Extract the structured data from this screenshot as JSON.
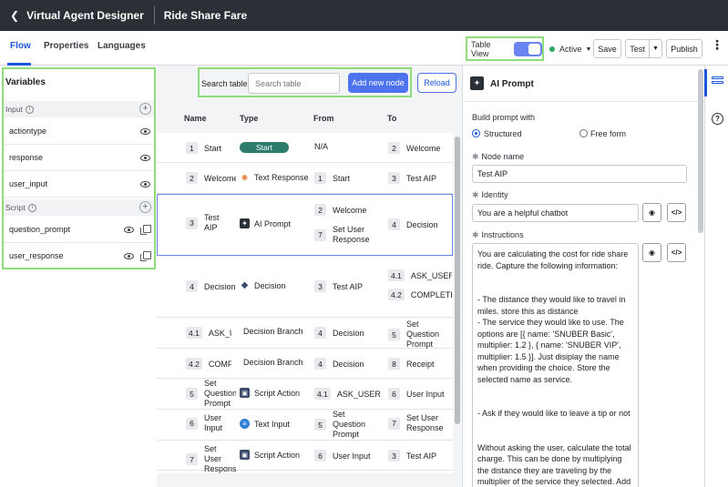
{
  "topbar": {
    "back_label": "Virtual Agent Designer",
    "title": "Ride Share Fare"
  },
  "tabs": [
    {
      "label": "Flow"
    },
    {
      "label": "Properties"
    },
    {
      "label": "Languages"
    }
  ],
  "toolbar": {
    "table_view_label": "Table View",
    "table_view_on": true,
    "status_label": "Active",
    "save_label": "Save",
    "test_label": "Test",
    "publish_label": "Publish"
  },
  "variables": {
    "title": "Variables",
    "input_label": "Input",
    "input_items": [
      {
        "name": "actiontype"
      },
      {
        "name": "response"
      },
      {
        "name": "user_input"
      }
    ],
    "script_label": "Script",
    "script_items": [
      {
        "name": "question_prompt"
      },
      {
        "name": "user_response"
      }
    ]
  },
  "search": {
    "label": "Search table",
    "placeholder": "Search table",
    "add_label": "Add new node",
    "reload_label": "Reload"
  },
  "table": {
    "headers": {
      "name": "Name",
      "type": "Type",
      "from": "From",
      "to": "To"
    },
    "rows": [
      {
        "num": "1",
        "name": "Start",
        "type": "Start",
        "from": [
          {
            "num": "",
            "label": "N/A"
          }
        ],
        "to": [
          {
            "num": "2",
            "label": "Welcome"
          }
        ]
      },
      {
        "num": "2",
        "name": "Welcome",
        "type": "Text Response",
        "from": [
          {
            "num": "1",
            "label": "Start"
          }
        ],
        "to": [
          {
            "num": "3",
            "label": "Test AIP"
          }
        ]
      },
      {
        "num": "3",
        "name": "Test AIP",
        "type": "AI Prompt",
        "from": [
          {
            "num": "2",
            "label": "Welcome"
          },
          {
            "num": "7",
            "label": "Set User Response"
          }
        ],
        "to": [
          {
            "num": "4",
            "label": "Decision"
          }
        ]
      },
      {
        "num": "4",
        "name": "Decision",
        "type": "Decision",
        "from": [
          {
            "num": "3",
            "label": "Test AIP"
          }
        ],
        "to": [
          {
            "num": "4.1",
            "label": "ASK_USER"
          },
          {
            "num": "4.2",
            "label": "COMPLETE"
          }
        ]
      },
      {
        "num": "4.1",
        "name": "ASK_USER",
        "type": "Decision Branch",
        "from": [
          {
            "num": "4",
            "label": "Decision"
          }
        ],
        "to": [
          {
            "num": "5",
            "label": "Set Question Prompt"
          }
        ]
      },
      {
        "num": "4.2",
        "name": "COMPLETE",
        "type": "Decision Branch",
        "from": [
          {
            "num": "4",
            "label": "Decision"
          }
        ],
        "to": [
          {
            "num": "8",
            "label": "Receipt"
          }
        ]
      },
      {
        "num": "5",
        "name": "Set Question Prompt",
        "type": "Script Action",
        "from": [
          {
            "num": "4.1",
            "label": "ASK_USER"
          }
        ],
        "to": [
          {
            "num": "6",
            "label": "User Input"
          }
        ]
      },
      {
        "num": "6",
        "name": "User Input",
        "type": "Text Input",
        "from": [
          {
            "num": "5",
            "label": "Set Question Prompt"
          }
        ],
        "to": [
          {
            "num": "7",
            "label": "Set User Response"
          }
        ]
      },
      {
        "num": "7",
        "name": "Set User Response",
        "type": "Script Action",
        "from": [
          {
            "num": "6",
            "label": "User Input"
          }
        ],
        "to": [
          {
            "num": "3",
            "label": "Test AIP"
          }
        ]
      }
    ]
  },
  "panel": {
    "title": "AI Prompt",
    "build_label": "Build prompt with",
    "option_structured": "Structured",
    "option_freeform": "Free form",
    "node_name_label": "Node name",
    "node_name_value": "Test AIP",
    "identity_label": "Identity",
    "identity_value": "You are a helpful chatbot",
    "instructions_label": "Instructions",
    "instructions_text": "You are calculating the cost for ride share ride. Capture the following information:\n\n\n- The distance they would like to travel in miles. store this as distance\n- The service they would like to use. The options are [{ name: 'SNUBER Basic', multiplier: 1.2 }, { name: 'SNUBER VIP', multiplier: 1.5 }]. Just disiplay the name when providing the choice. Store the selected name as service.\n\n\n- Ask if they would like to leave a tip or not\n\n\nWithout asking the user, calculate the total charge. This can be done by multiplying the distance they are traveling by the multiplier of the service they selected. Add this value to the data collected, store it as total_charge."
  }
}
